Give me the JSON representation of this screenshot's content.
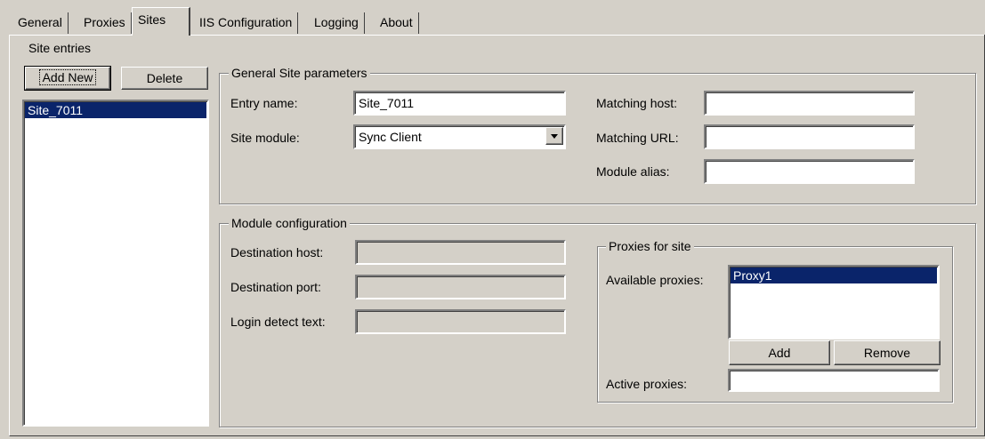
{
  "tabs": [
    {
      "label": "General"
    },
    {
      "label": "Proxies"
    },
    {
      "label": "Sites"
    },
    {
      "label": "IIS Configuration"
    },
    {
      "label": "Logging"
    },
    {
      "label": "About"
    }
  ],
  "site_entries": {
    "label": "Site entries",
    "add_new_label": "Add New",
    "delete_label": "Delete",
    "items": [
      "Site_7011"
    ]
  },
  "general_params": {
    "title": "General Site parameters",
    "entry_name_label": "Entry name:",
    "entry_name_value": "Site_7011",
    "site_module_label": "Site module:",
    "site_module_value": "Sync Client",
    "matching_host_label": "Matching host:",
    "matching_host_value": "",
    "matching_url_label": "Matching URL:",
    "matching_url_value": "",
    "module_alias_label": "Module alias:",
    "module_alias_value": ""
  },
  "module_config": {
    "title": "Module configuration",
    "destination_host_label": "Destination host:",
    "destination_port_label": "Destination port:",
    "login_detect_label": "Login detect text:"
  },
  "proxies_for_site": {
    "title": "Proxies for site",
    "available_label": "Available proxies:",
    "available_items": [
      "Proxy1"
    ],
    "add_label": "Add",
    "remove_label": "Remove",
    "active_label": "Active proxies:",
    "active_value": ""
  },
  "icons": {
    "combo_arrow": "chevron-down-icon"
  }
}
